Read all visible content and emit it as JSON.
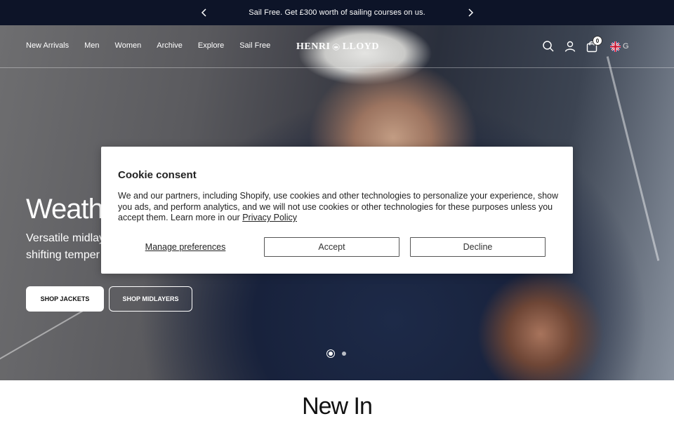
{
  "announcement": {
    "text": "Sail Free. Get £300 worth of sailing courses on us."
  },
  "header": {
    "nav": [
      "New Arrivals",
      "Men",
      "Women",
      "Archive",
      "Explore",
      "Sail Free"
    ],
    "logo": {
      "left": "HENRI",
      "right": "LLOYD"
    },
    "cart_count": "0",
    "country_code": "G"
  },
  "hero": {
    "title": "Weath",
    "subtitle_line1": "Versatile midlay",
    "subtitle_line2": "shifting temper",
    "primary_button": "SHOP JACKETS",
    "secondary_button": "SHOP MIDLAYERS",
    "slides": {
      "current": 1,
      "total": 2
    }
  },
  "section": {
    "title": "New In"
  },
  "cookie": {
    "title": "Cookie consent",
    "body": "We and our partners, including Shopify, use cookies and other technologies to personalize your experience, show you ads, and perform analytics, and we will not use cookies or other technologies for these purposes unless you accept them. Learn more in our ",
    "link": "Privacy Policy",
    "manage": "Manage preferences",
    "accept": "Accept",
    "decline": "Decline"
  },
  "icons": [
    "chevron-left-icon",
    "chevron-right-icon",
    "crown-crest-icon",
    "search-icon",
    "account-icon",
    "bag-icon",
    "uk-flag-icon"
  ],
  "colors": {
    "announcement_bg": "#0d1428",
    "white": "#ffffff",
    "text_dark": "#222222"
  }
}
